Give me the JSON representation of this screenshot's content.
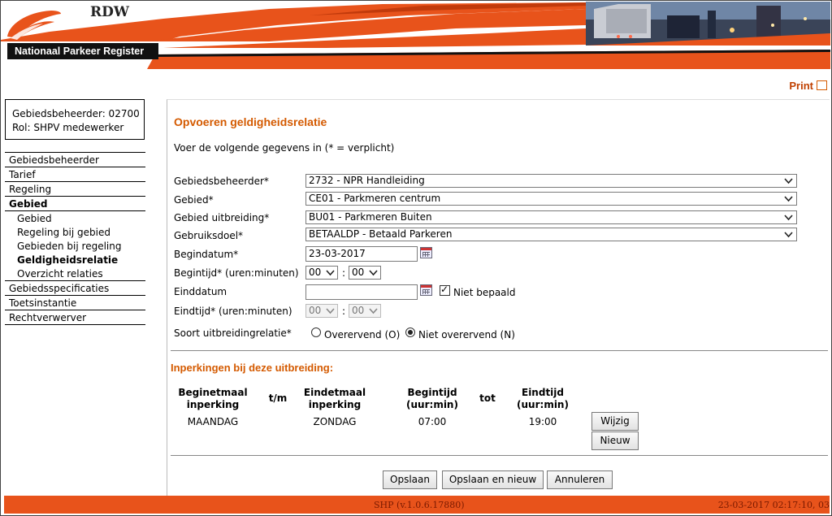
{
  "header": {
    "logo_text": "RDW",
    "app_name": "Nationaal Parkeer Register",
    "print_label": "Print"
  },
  "user": {
    "manager_line": "Gebiedsbeheerder: 02700",
    "role_line": "Rol: SHPV medewerker"
  },
  "nav": {
    "items": [
      {
        "label": "Gebiedsbeheerder"
      },
      {
        "label": "Tarief"
      },
      {
        "label": "Regeling"
      },
      {
        "label": "Gebied"
      },
      {
        "label": "Gebied"
      },
      {
        "label": "Regeling bij gebied"
      },
      {
        "label": "Gebieden bij regeling"
      },
      {
        "label": "Geldigheidsrelatie"
      },
      {
        "label": "Overzicht relaties"
      },
      {
        "label": "Gebiedsspecificaties"
      },
      {
        "label": "Toetsinstantie"
      },
      {
        "label": "Rechtverwerver"
      }
    ]
  },
  "form": {
    "title": "Opvoeren geldigheidsrelatie",
    "intro": "Voer de volgende gegevens in (* = verplicht)",
    "labels": {
      "manager": "Gebiedsbeheerder*",
      "area": "Gebied*",
      "area_ext": "Gebied uitbreiding*",
      "purpose": "Gebruiksdoel*",
      "start_date": "Begindatum*",
      "start_time": "Begintijd* (uren:minuten)",
      "end_date": "Einddatum",
      "end_time": "Eindtijd* (uren:minuten)",
      "relation_type": "Soort uitbreidingrelatie*"
    },
    "values": {
      "manager": "2732 - NPR Handleiding",
      "area": "CE01 - Parkmeren centrum",
      "area_ext": "BU01 - Parkmeren Buiten",
      "purpose": "BETAALDP - Betaald Parkeren",
      "start_date": "23-03-2017",
      "start_hour": "00",
      "start_min": "00",
      "end_date": "",
      "end_hour": "00",
      "end_min": "00"
    },
    "not_set_label": "Niet bepaald",
    "not_set_checked": true,
    "time_separator": ":",
    "radio_inherit": "Overervend (O)",
    "radio_not_inherit": "Niet overervend (N)",
    "radio_selected": "not_inherit"
  },
  "restrictions": {
    "title": "Inperkingen bij deze uitbreiding:",
    "headers": {
      "start_day": "Beginetmaal\ninperking",
      "through": "t/m",
      "end_day": "Eindetmaal\ninperking",
      "start_time": "Begintijd\n(uur:min)",
      "until": "tot",
      "end_time": "Eindtijd\n(uur:min)"
    },
    "rows": [
      {
        "start_day": "MAANDAG",
        "end_day": "ZONDAG",
        "start_time": "07:00",
        "end_time": "19:00"
      }
    ],
    "edit_label": "Wijzig",
    "new_label": "Nieuw"
  },
  "actions": {
    "save": "Opslaan",
    "save_new": "Opslaan en nieuw",
    "cancel": "Annuleren"
  },
  "footer": {
    "version": "SHP (v.1.0.6.17880)",
    "timestamp": "23-03-2017 02:17:10, 03"
  },
  "colors": {
    "accent": "#e8531b",
    "title": "#d45a00"
  }
}
